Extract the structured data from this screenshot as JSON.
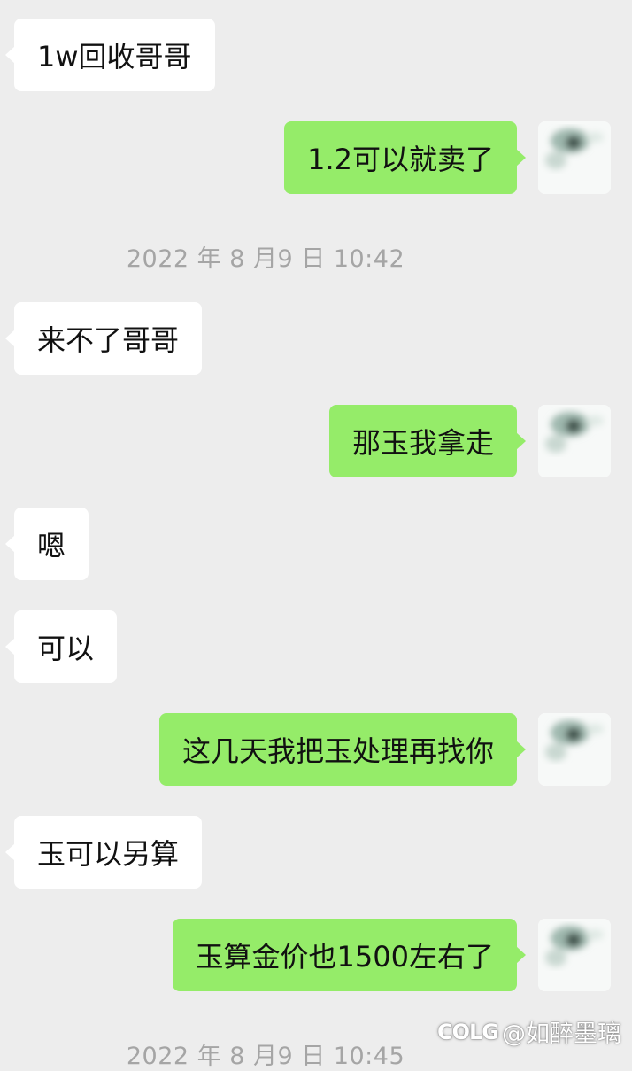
{
  "chat": {
    "messages": [
      {
        "from": "contact",
        "text": "1w回收哥哥"
      },
      {
        "from": "me",
        "text": "1.2可以就卖了"
      },
      {
        "from": "contact",
        "text": "来不了哥哥"
      },
      {
        "from": "me",
        "text": "那玉我拿走"
      },
      {
        "from": "contact",
        "text": "嗯"
      },
      {
        "from": "contact",
        "text": "可以"
      },
      {
        "from": "me",
        "text": "这几天我把玉处理再找你"
      },
      {
        "from": "contact",
        "text": "玉可以另算"
      },
      {
        "from": "me",
        "text": "玉算金价也1500左右了"
      }
    ],
    "timestamps": [
      "2022 年 8 月9 日 10:42",
      "2022 年 8 月9 日 10:45"
    ]
  },
  "watermark": {
    "logo": "COLG",
    "handle": "@如醉墨璃"
  },
  "colors": {
    "background": "#ededed",
    "incoming_bubble": "#ffffff",
    "outgoing_bubble": "#95ec69",
    "timestamp_text": "#a5a5a5"
  },
  "icons": {
    "my_avatar": "blurry-avatar-photo"
  }
}
